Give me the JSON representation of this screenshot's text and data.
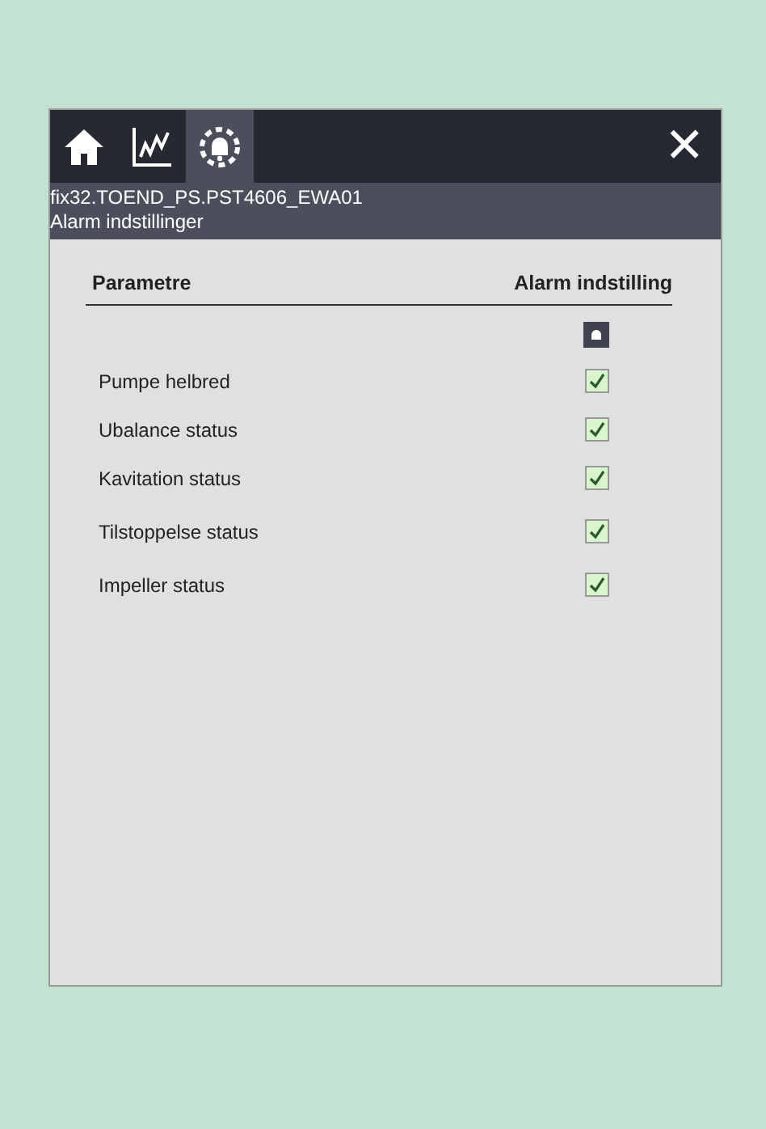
{
  "tabs": [
    {
      "kind": "home",
      "selected": false
    },
    {
      "kind": "chart",
      "selected": false
    },
    {
      "kind": "bell",
      "selected": true
    }
  ],
  "close": "✕",
  "header": {
    "tag": "fix32.TOEND_PS.PST4606_EWA01",
    "subtitle": "Alarm indstillinger"
  },
  "table": {
    "columns": [
      "Parametre",
      "Alarm indstilling"
    ],
    "rows": [
      {
        "label": "Pumpe helbred",
        "checked": true
      },
      {
        "label": "Ubalance status",
        "checked": true
      },
      {
        "label": "Kavitation status",
        "checked": true
      },
      {
        "label": "Tilstoppelse status",
        "checked": true
      },
      {
        "label": "Impeller status",
        "checked": true
      }
    ]
  }
}
